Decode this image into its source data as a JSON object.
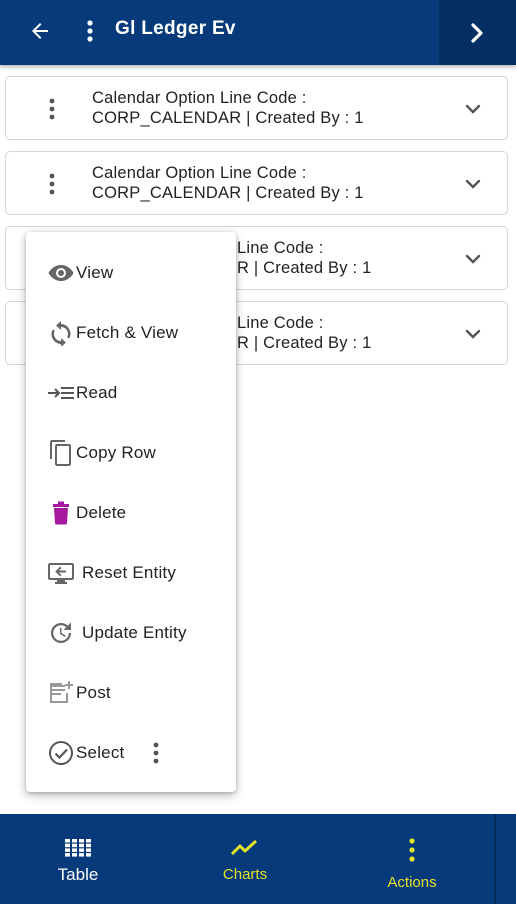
{
  "header": {
    "title": "Gl Ledger Ev",
    "back_icon": "arrow-left-icon",
    "menu_icon": "kebab-vertical-icon",
    "next_icon": "chevron-right-icon"
  },
  "records": [
    {
      "line1": "Calendar Option Line Code  :",
      "line2": "CORP_CALENDAR | Created By  : 1"
    },
    {
      "line1": "Calendar Option Line Code  :",
      "line2": "CORP_CALENDAR | Created By  : 1"
    },
    {
      "line1": "Line Code  :",
      "line2": "R | Created By  : 1"
    },
    {
      "line1": "Line Code  :",
      "line2": "R | Created By  : 1"
    }
  ],
  "context_menu": {
    "items": [
      {
        "label": "View",
        "icon": "eye-icon"
      },
      {
        "label": "Fetch & View",
        "icon": "refresh-icon"
      },
      {
        "label": "Read",
        "icon": "read-arrow-list-icon"
      },
      {
        "label": "Copy Row",
        "icon": "copy-icon"
      },
      {
        "label": "Delete",
        "icon": "trash-icon"
      },
      {
        "label": "Reset Entity",
        "icon": "reset-screen-icon"
      },
      {
        "label": "Update Entity",
        "icon": "update-clock-icon"
      },
      {
        "label": "Post",
        "icon": "post-note-icon"
      },
      {
        "label": "Select",
        "icon": "check-circle-icon"
      }
    ]
  },
  "bottom_nav": {
    "table": {
      "label": "Table",
      "icon": "grid-icon"
    },
    "charts": {
      "label": "Charts",
      "icon": "line-chart-icon"
    },
    "actions": {
      "label": "Actions",
      "icon": "kebab-vertical-icon"
    }
  },
  "colors": {
    "primary": "#063a7a",
    "accent": "#e3e32a",
    "delete": "#a6189e",
    "icon_gray": "#666666"
  }
}
